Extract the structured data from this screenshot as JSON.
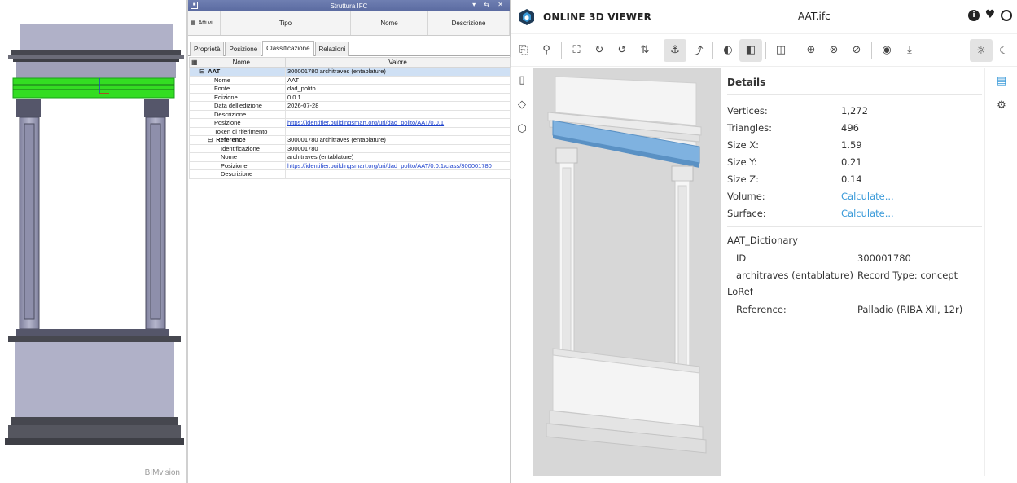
{
  "bimvision": {
    "watermark": "BIMvision"
  },
  "ifc_panel": {
    "title": "Struttura IFC",
    "columns": {
      "active": "Atti vi",
      "type": "Tipo",
      "name": "Nome",
      "description": "Descrizione"
    },
    "tabs": [
      "Proprietà",
      "Posizione",
      "Classificazione",
      "Relazioni"
    ],
    "active_tab": "Classificazione",
    "table_headers": {
      "name": "Nome",
      "value": "Valore"
    },
    "rows": [
      {
        "name": "AAT",
        "value": "300001780 architraves (entablature)"
      },
      {
        "name": "Nome",
        "value": "AAT"
      },
      {
        "name": "Fonte",
        "value": "dad_polito"
      },
      {
        "name": "Edizione",
        "value": "0.0.1"
      },
      {
        "name": "Data dell'edizione",
        "value": "2026-07-28"
      },
      {
        "name": "Descrizione",
        "value": ""
      },
      {
        "name": "Posizione",
        "value": "https://identifier.buildingsmart.org/uri/dad_polito/AAT/0.0.1"
      },
      {
        "name": "Token di riferimento",
        "value": ""
      },
      {
        "name": "Reference",
        "value": "300001780 architraves (entablature)"
      },
      {
        "name": "Identificazione",
        "value": "300001780"
      },
      {
        "name": "Nome",
        "value": "architraves (entablature)"
      },
      {
        "name": "Posizione",
        "value": "https://identifier.buildingsmart.org/uri/dad_polito/AAT/0.0.1/class/300001780"
      },
      {
        "name": "Descrizione",
        "value": ""
      }
    ]
  },
  "viewer": {
    "app_title": "ONLINE 3D VIEWER",
    "file_name": "AAT.ifc",
    "header_icons": [
      "info-icon",
      "heart-icon",
      "github-icon"
    ],
    "details": {
      "title": "Details",
      "properties": [
        {
          "label": "Vertices:",
          "value": "1,272"
        },
        {
          "label": "Triangles:",
          "value": "496"
        },
        {
          "label": "Size X:",
          "value": "1.59"
        },
        {
          "label": "Size Y:",
          "value": "0.21"
        },
        {
          "label": "Size Z:",
          "value": "0.14"
        },
        {
          "label": "Volume:",
          "value": "Calculate..."
        },
        {
          "label": "Surface:",
          "value": "Calculate..."
        }
      ],
      "groups": [
        {
          "name": "AAT_Dictionary",
          "rows": [
            {
              "label": "ID",
              "value": "300001780"
            },
            {
              "label": "architraves (entablature)",
              "value": "Record Type: concept"
            }
          ]
        },
        {
          "name": "LoRef",
          "rows": [
            {
              "label": "Reference:",
              "value": "Palladio (RIBA XII, 12r)"
            }
          ]
        }
      ]
    },
    "colors": {
      "accent": "#3a9ad9",
      "selection": "#7fb2e0",
      "highlight_green": "#33dd22"
    }
  }
}
